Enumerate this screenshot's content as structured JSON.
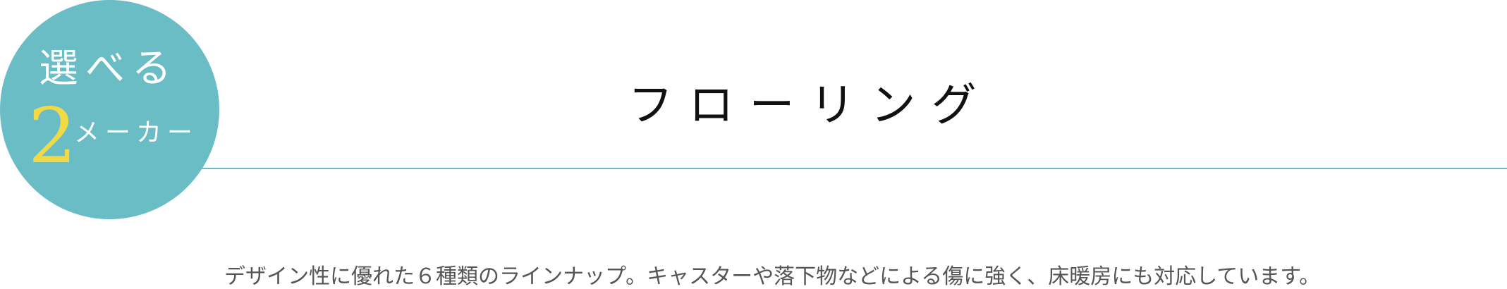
{
  "badge": {
    "line1": "選べる",
    "number": "2",
    "line2": "メーカー"
  },
  "title": "フローリング",
  "description": "デザイン性に優れた６種類のラインナップ。キャスターや落下物などによる傷に強く、床暖房にも対応しています。",
  "colors": {
    "badge_background": "#6bbdc5",
    "badge_text": "#ffffff",
    "badge_number": "#f2da47",
    "rule": "#6bbdc5",
    "title_text": "#111111",
    "description_text": "#555555"
  }
}
